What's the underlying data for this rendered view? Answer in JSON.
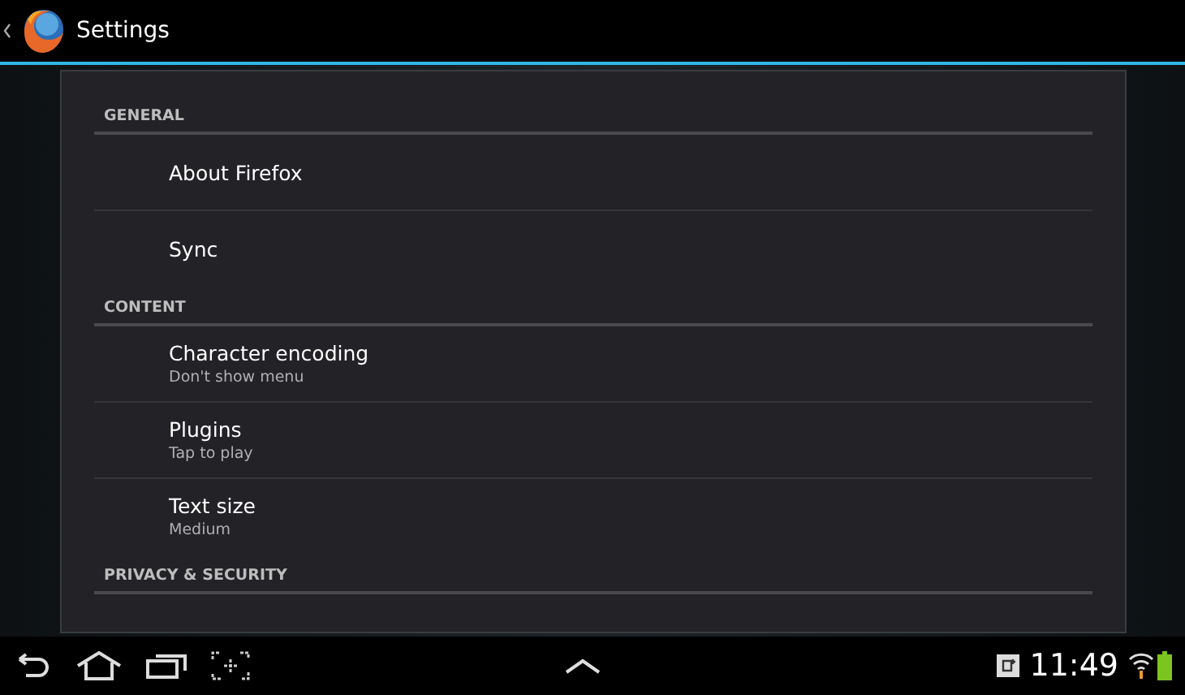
{
  "action_bar": {
    "title": "Settings"
  },
  "sections": [
    {
      "title": "GENERAL",
      "items": [
        {
          "title": "About Firefox"
        },
        {
          "title": "Sync"
        }
      ]
    },
    {
      "title": "CONTENT",
      "items": [
        {
          "title": "Character encoding",
          "summary": "Don't show menu"
        },
        {
          "title": "Plugins",
          "summary": "Tap to play"
        },
        {
          "title": "Text size",
          "summary": "Medium"
        }
      ]
    },
    {
      "title": "PRIVACY & SECURITY"
    }
  ],
  "status_bar": {
    "time": "11:49"
  }
}
